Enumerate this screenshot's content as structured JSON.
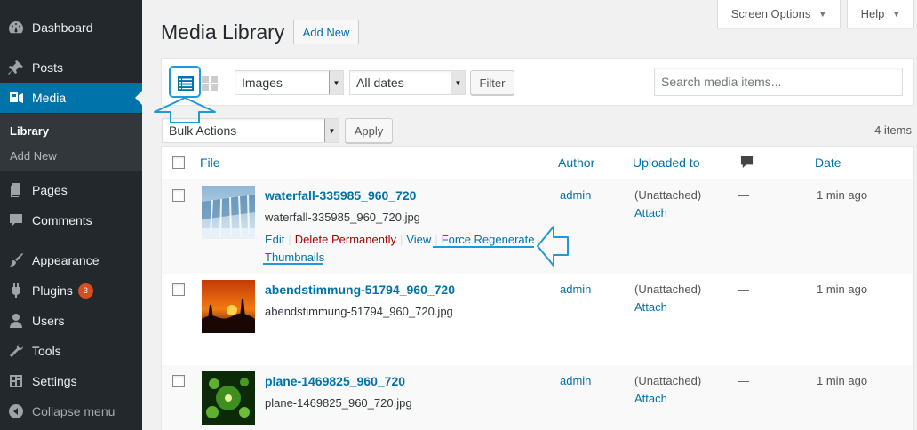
{
  "sidebar": {
    "items": [
      {
        "label": "Dashboard"
      },
      {
        "label": "Posts"
      },
      {
        "label": "Media"
      },
      {
        "label": "Pages"
      },
      {
        "label": "Comments"
      },
      {
        "label": "Appearance"
      },
      {
        "label": "Plugins",
        "badge": "3"
      },
      {
        "label": "Users"
      },
      {
        "label": "Tools"
      },
      {
        "label": "Settings"
      },
      {
        "label": "Collapse menu"
      }
    ],
    "submenu": [
      {
        "label": "Library"
      },
      {
        "label": "Add New"
      }
    ]
  },
  "topbar": {
    "screen_options": "Screen Options",
    "help": "Help"
  },
  "header": {
    "title": "Media Library",
    "add_new": "Add New"
  },
  "filters": {
    "type_selected": "Images",
    "date_selected": "All dates",
    "filter_button": "Filter",
    "search_placeholder": "Search media items..."
  },
  "bulk": {
    "selected": "Bulk Actions",
    "apply": "Apply",
    "count": "4 items"
  },
  "table": {
    "headers": {
      "file": "File",
      "author": "Author",
      "uploaded_to": "Uploaded to",
      "date": "Date"
    },
    "rows": [
      {
        "title": "waterfall-335985_960_720",
        "filename": "waterfall-335985_960_720.jpg",
        "author": "admin",
        "uploaded": "(Unattached)",
        "attach": "Attach",
        "comments": "—",
        "date": "1 min ago",
        "actions": {
          "edit": "Edit",
          "delete": "Delete Permanently",
          "view": "View",
          "regen1": "Force Regenerate",
          "regen2": "Thumbnails"
        }
      },
      {
        "title": "abendstimmung-51794_960_720",
        "filename": "abendstimmung-51794_960_720.jpg",
        "author": "admin",
        "uploaded": "(Unattached)",
        "attach": "Attach",
        "comments": "—",
        "date": "1 min ago"
      },
      {
        "title": "plane-1469825_960_720",
        "filename": "plane-1469825_960_720.jpg",
        "author": "admin",
        "uploaded": "(Unattached)",
        "attach": "Attach",
        "comments": "—",
        "date": "1 min ago"
      }
    ]
  },
  "colors": {
    "sidebar_bg": "#23282d",
    "accent": "#0073aa",
    "annotation": "#1e9bd7",
    "delete": "#aa0000"
  }
}
